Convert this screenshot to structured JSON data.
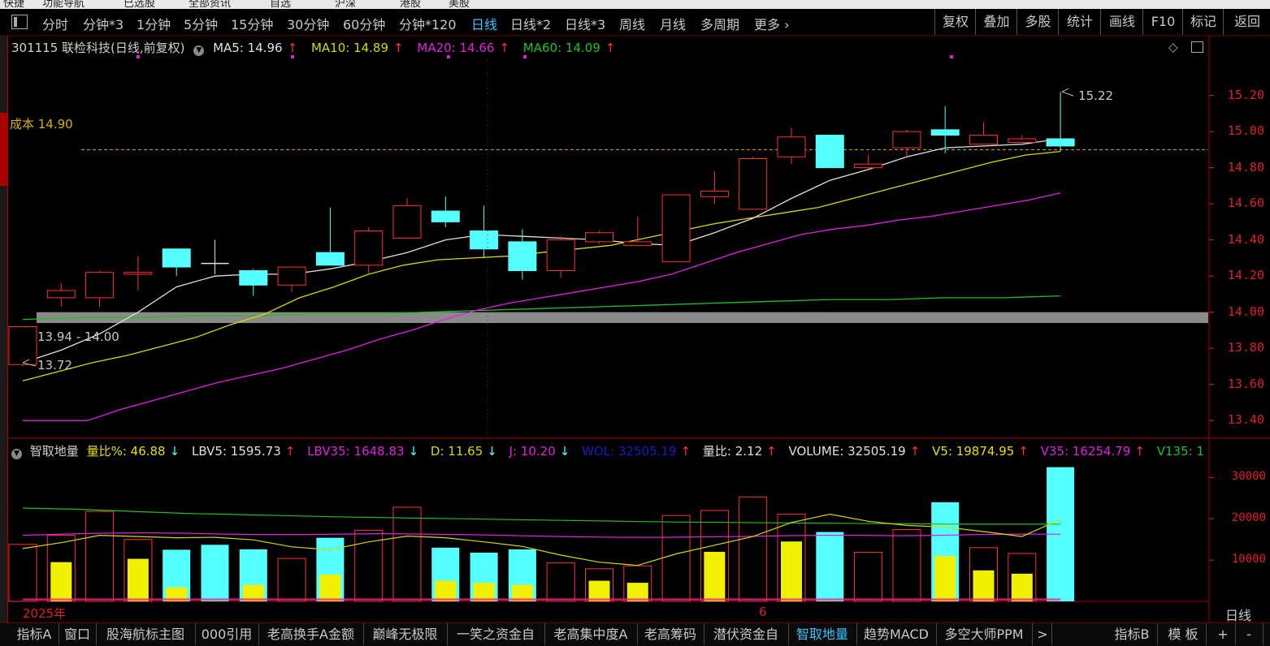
{
  "top_strip": {
    "fragments": [
      "快捷",
      "功能导航",
      "已选股",
      "全部资讯",
      "自选",
      "沪深",
      "港股",
      "美股"
    ]
  },
  "period_tabs": [
    {
      "label": "分时",
      "active": false
    },
    {
      "label": "分钟*3",
      "active": false
    },
    {
      "label": "1分钟",
      "active": false
    },
    {
      "label": "5分钟",
      "active": false
    },
    {
      "label": "15分钟",
      "active": false
    },
    {
      "label": "30分钟",
      "active": false
    },
    {
      "label": "60分钟",
      "active": false
    },
    {
      "label": "分钟*120",
      "active": false
    },
    {
      "label": "日线",
      "active": true
    },
    {
      "label": "日线*2",
      "active": false
    },
    {
      "label": "日线*3",
      "active": false
    },
    {
      "label": "周线",
      "active": false
    },
    {
      "label": "月线",
      "active": false
    },
    {
      "label": "多周期",
      "active": false
    },
    {
      "label": "更多",
      "active": false
    }
  ],
  "right_tools": [
    "复权",
    "叠加",
    "多股",
    "统计",
    "画线",
    "F10",
    "标记",
    "返回"
  ],
  "header": {
    "stock": "301115 联检科技(日线,前复权)",
    "ma5": "MA5: 14.96",
    "ma10": "MA10: 14.89",
    "ma20": "MA20: 14.66",
    "ma60": "MA60: 14.09",
    "up_arrow": "↑",
    "down_arrow": "↓"
  },
  "cost_line": {
    "label": "成本 14.90",
    "price": 14.9
  },
  "annotations": {
    "high": "15.22",
    "low": "13.72",
    "gap": "13.94 - 14.00",
    "gap_low": 13.94,
    "gap_high": 14.0
  },
  "price_axis": {
    "ticks": [
      "15.20",
      "15.00",
      "14.80",
      "14.60",
      "14.40",
      "14.20",
      "14.00",
      "13.80",
      "13.60",
      "13.40"
    ],
    "min": 13.32,
    "max": 15.36
  },
  "volume_axis": {
    "ticks": [
      "30000",
      "20000",
      "10000"
    ],
    "max": 34000
  },
  "indicator": {
    "name": "智取地量",
    "liangbi_pct": "量比%: 46.88",
    "lbv5": "LBV5: 1595.73",
    "lbv35": "LBV35: 1648.83",
    "d": "D: 11.65",
    "j": "J: 10.20",
    "wol": "WOL: 32505.19",
    "liangbi": "量比: 2.12",
    "volume": "VOLUME: 32505.19",
    "v5": "V5: 19874.95",
    "v35": "V35: 16254.79",
    "v135": "V135: 1"
  },
  "time_axis": {
    "year": "2025年",
    "month": "6",
    "period_label": "日线"
  },
  "bottom_tabs": [
    {
      "label": "指标A",
      "active": false
    },
    {
      "label": "窗口",
      "active": false
    },
    {
      "label": "股海航标主图",
      "active": false
    },
    {
      "label": "000引用",
      "active": false
    },
    {
      "label": "老高换手A金额",
      "active": false
    },
    {
      "label": "巅峰无极限",
      "active": false
    },
    {
      "label": "一笑之资金自",
      "active": false
    },
    {
      "label": "老高集中度A",
      "active": false
    },
    {
      "label": "老高筹码",
      "active": false
    },
    {
      "label": "潜伏资金自",
      "active": false
    },
    {
      "label": "智取地量",
      "active": true
    },
    {
      "label": "趋势MACD",
      "active": false
    },
    {
      "label": "多空大师PPM",
      "active": false
    }
  ],
  "bottom_right": [
    "指标B",
    "模 板",
    "+",
    "-"
  ],
  "colors": {
    "up": "#ff3030",
    "down": "#54ffff",
    "ma5": "#e0e0e0",
    "ma10": "#d8d800",
    "ma20": "#e020e0",
    "ma60": "#20c020",
    "axis": "#e02020",
    "active": "#36c7ff"
  },
  "chart_data": {
    "type": "candlestick",
    "candles": [
      {
        "o": 13.71,
        "c": 13.92,
        "h": 13.92,
        "l": 13.7
      },
      {
        "o": 14.08,
        "c": 14.12,
        "h": 14.16,
        "l": 14.03
      },
      {
        "o": 14.08,
        "c": 14.22,
        "h": 14.23,
        "l": 14.03
      },
      {
        "o": 14.21,
        "c": 14.22,
        "h": 14.31,
        "l": 14.12
      },
      {
        "o": 14.35,
        "c": 14.25,
        "h": 14.35,
        "l": 14.2
      },
      {
        "o": 14.27,
        "c": 14.27,
        "h": 14.4,
        "l": 14.21
      },
      {
        "o": 14.23,
        "c": 14.15,
        "h": 14.24,
        "l": 14.09
      },
      {
        "o": 14.15,
        "c": 14.25,
        "h": 14.25,
        "l": 14.11
      },
      {
        "o": 14.33,
        "c": 14.26,
        "h": 14.58,
        "l": 14.26
      },
      {
        "o": 14.26,
        "c": 14.45,
        "h": 14.47,
        "l": 14.21
      },
      {
        "o": 14.41,
        "c": 14.59,
        "h": 14.63,
        "l": 14.41
      },
      {
        "o": 14.56,
        "c": 14.5,
        "h": 14.64,
        "l": 14.47
      },
      {
        "o": 14.45,
        "c": 14.35,
        "h": 14.59,
        "l": 14.3
      },
      {
        "o": 14.39,
        "c": 14.23,
        "h": 14.46,
        "l": 14.18
      },
      {
        "o": 14.23,
        "c": 14.4,
        "h": 14.42,
        "l": 14.19
      },
      {
        "o": 14.39,
        "c": 14.44,
        "h": 14.45,
        "l": 14.38
      },
      {
        "o": 14.37,
        "c": 14.39,
        "h": 14.53,
        "l": 14.37
      },
      {
        "o": 14.28,
        "c": 14.65,
        "h": 14.65,
        "l": 14.28
      },
      {
        "o": 14.64,
        "c": 14.67,
        "h": 14.78,
        "l": 14.6
      },
      {
        "o": 14.57,
        "c": 14.85,
        "h": 14.86,
        "l": 14.57
      },
      {
        "o": 14.86,
        "c": 14.97,
        "h": 15.02,
        "l": 14.82
      },
      {
        "o": 14.98,
        "c": 14.8,
        "h": 14.98,
        "l": 14.8
      },
      {
        "o": 14.8,
        "c": 14.82,
        "h": 14.87,
        "l": 14.79
      },
      {
        "o": 14.91,
        "c": 15.0,
        "h": 15.01,
        "l": 14.86
      },
      {
        "o": 15.01,
        "c": 14.98,
        "h": 15.14,
        "l": 14.88
      },
      {
        "o": 14.93,
        "c": 14.98,
        "h": 15.05,
        "l": 14.93
      },
      {
        "o": 14.94,
        "c": 14.96,
        "h": 14.98,
        "l": 14.94
      },
      {
        "o": 14.96,
        "c": 14.92,
        "h": 15.22,
        "l": 14.89
      }
    ],
    "ma5": [
      13.72,
      13.79,
      13.88,
      14.0,
      14.14,
      14.2,
      14.21,
      14.21,
      14.24,
      14.28,
      14.33,
      14.4,
      14.43,
      14.42,
      14.41,
      14.4,
      14.38,
      14.37,
      14.44,
      14.52,
      14.63,
      14.73,
      14.79,
      14.86,
      14.91,
      14.92,
      14.93,
      14.96
    ],
    "ma10": [
      13.62,
      13.67,
      13.72,
      13.76,
      13.81,
      13.86,
      13.93,
      13.99,
      14.08,
      14.14,
      14.21,
      14.26,
      14.29,
      14.3,
      14.31,
      14.33,
      14.35,
      14.37,
      14.41,
      14.45,
      14.49,
      14.52,
      14.55,
      14.58,
      14.63,
      14.68,
      14.73,
      14.78,
      14.83,
      14.87,
      14.89
    ],
    "ma20": [
      13.4,
      13.4,
      13.4,
      13.46,
      13.51,
      13.56,
      13.61,
      13.65,
      13.69,
      13.74,
      13.79,
      13.85,
      13.9,
      13.96,
      14.01,
      14.05,
      14.08,
      14.11,
      14.14,
      14.17,
      14.21,
      14.27,
      14.33,
      14.38,
      14.43,
      14.46,
      14.48,
      14.51,
      14.53,
      14.56,
      14.59,
      14.62,
      14.66
    ],
    "ma60": [
      13.96,
      13.97,
      13.97,
      13.98,
      13.98,
      13.99,
      13.99,
      14.0,
      14.01,
      14.02,
      14.03,
      14.04,
      14.05,
      14.06,
      14.07,
      14.07,
      14.08,
      14.08,
      14.09
    ],
    "volume": [
      13800,
      16000,
      21800,
      15000,
      12500,
      13700,
      12600,
      10400,
      15400,
      17200,
      22800,
      13000,
      11800,
      12600,
      9300,
      7900,
      8600,
      20800,
      22000,
      25300,
      21100,
      16800,
      11900,
      17400,
      24000,
      13000,
      11600,
      32505
    ],
    "volume_up": [
      true,
      true,
      true,
      true,
      false,
      false,
      false,
      true,
      false,
      true,
      true,
      false,
      false,
      false,
      true,
      true,
      true,
      true,
      true,
      true,
      true,
      false,
      true,
      true,
      false,
      true,
      true,
      false
    ],
    "yellow_bars": [
      0,
      9500,
      0,
      10300,
      3400,
      0,
      4000,
      0,
      6500,
      0,
      0,
      5000,
      4500,
      4000,
      0,
      5000,
      4500,
      0,
      12000,
      0,
      14500,
      0,
      0,
      0,
      11000,
      7500,
      6700,
      0
    ],
    "v5_line": [
      12800,
      14200,
      16000,
      15700,
      15400,
      15500,
      14900,
      13200,
      12500,
      14400,
      15800,
      15400,
      14400,
      13300,
      11200,
      9500,
      8700,
      11500,
      13600,
      15700,
      19100,
      21100,
      19400,
      18400,
      18000,
      16900,
      15700,
      19875
    ],
    "v35_line": [
      16000,
      16300,
      16500,
      16600,
      16500,
      16300,
      16200,
      16200,
      16300,
      16400,
      16300,
      16200,
      16000,
      15800,
      15600,
      15500,
      15500,
      15600,
      15700,
      15900,
      16000,
      16000,
      15900,
      16000,
      16200,
      16300,
      16254
    ],
    "v135_line": [
      22600,
      22300,
      21800,
      21300,
      21000,
      20700,
      20400,
      20200,
      20000,
      19800,
      19600,
      19400,
      19200,
      19100,
      19000,
      18900,
      18800,
      18700,
      18700,
      18700
    ]
  }
}
